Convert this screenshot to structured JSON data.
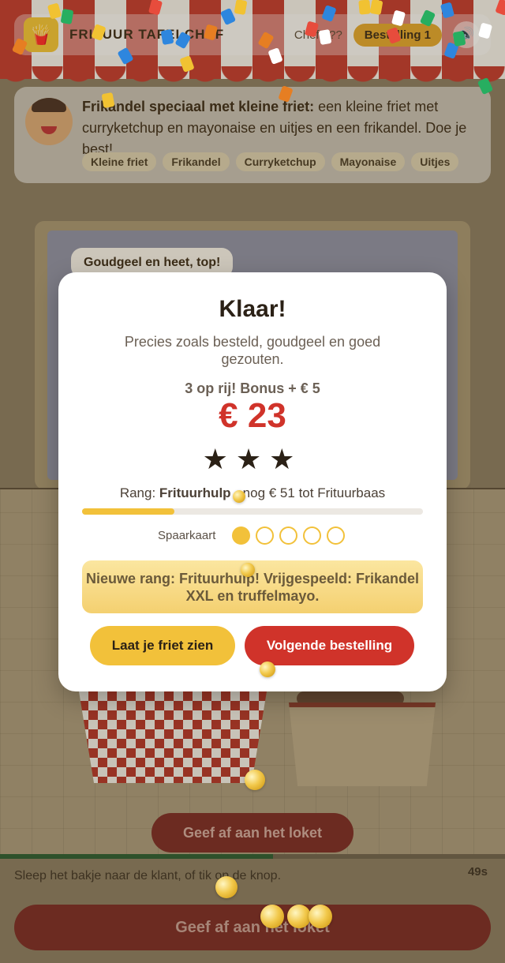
{
  "header": {
    "title": "FRITUUR TAFELCHEF",
    "chef_label": "Chef ???",
    "order_badge": "Bestelling 1",
    "logo_icon": "fries-icon",
    "sound_icon": "speaker-icon"
  },
  "order": {
    "name": "Frikandel speciaal met kleine friet:",
    "description": " een kleine friet met curryketchup en mayonaise en uitjes en een frikandel. Doe je best!",
    "tags": [
      "Kleine friet",
      "Frikandel",
      "Curryketchup",
      "Mayonaise",
      "Uitjes"
    ]
  },
  "customer_bubble": "Goudgeel en heet, top!",
  "actions": {
    "handoff_small": "Geef af aan het loket",
    "handoff_big": "Geef af aan het loket",
    "hint": "Sleep het bakje naar de klant, of tik op de knop.",
    "timer": "49s",
    "timer_remaining_fraction": 0.54
  },
  "modal": {
    "title": "Klaar!",
    "subtitle": "Precies zoals besteld, goudgeel en goed gezouten.",
    "bonus": "3 op rij! Bonus + € 5",
    "amount": "€ 23",
    "stars": "★★★",
    "stars_earned": 3,
    "rank_prefix": "Rang: ",
    "rank_name": "Frituurhulp",
    "rank_suffix": " · nog € 51 tot Frituurbaas",
    "rank_progress_fraction": 0.27,
    "loyalty_label": "Spaarkaart",
    "loyalty_filled": 1,
    "loyalty_total": 5,
    "unlock_message": "Nieuwe rang: Frituurhulp! Vrijgespeeld: Frikandel XXL en truffelmayo.",
    "show_button": "Laat je friet zien",
    "next_button": "Volgende bestelling"
  },
  "colors": {
    "accent_red": "#d0332a",
    "accent_yellow": "#f2c13a"
  }
}
